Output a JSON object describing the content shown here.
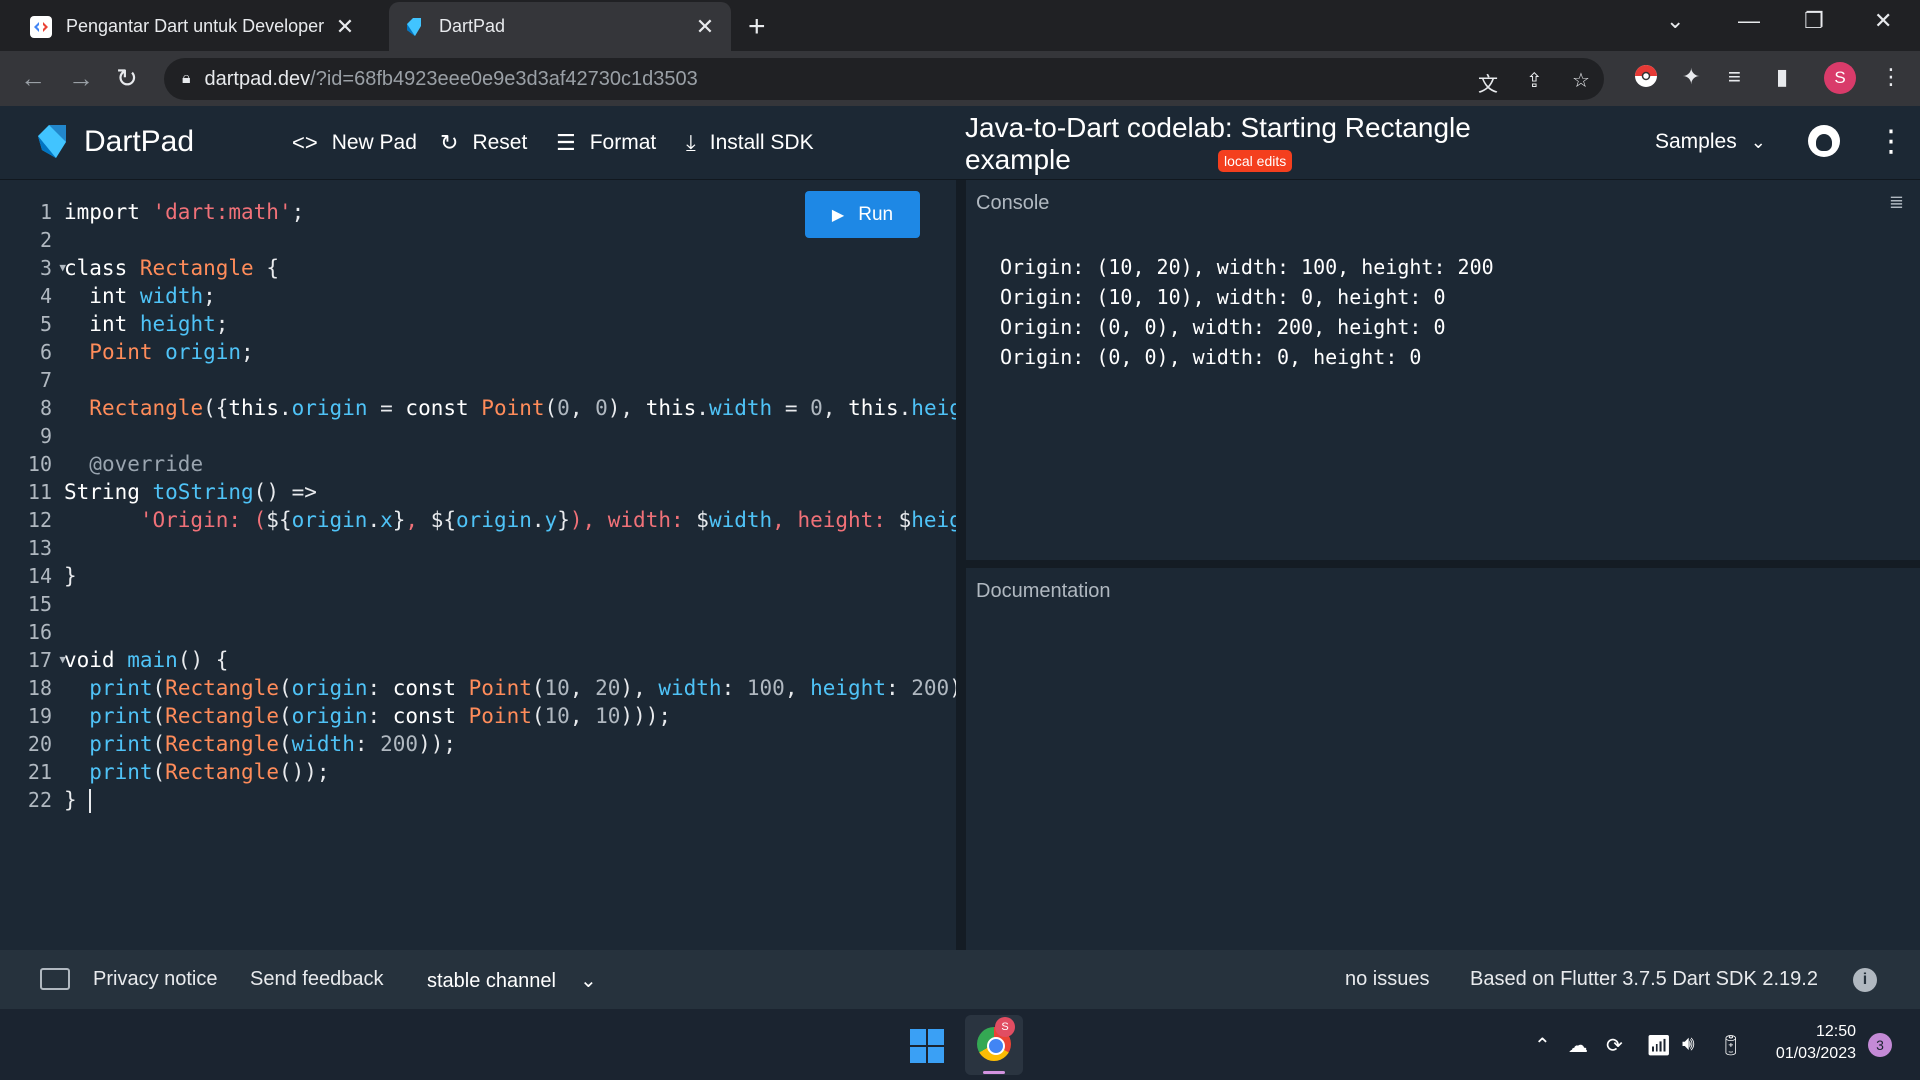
{
  "browser": {
    "tabs": [
      {
        "title": "Pengantar Dart untuk Developer",
        "active": false
      },
      {
        "title": "DartPad",
        "active": true
      }
    ],
    "new_tab": "+",
    "url_host": "dartpad.dev",
    "url_rest": "/?id=68fb4923eee0e9e3d3af42730c1d3503",
    "profile_initial": "S"
  },
  "header": {
    "app_name": "DartPad",
    "new_pad": "New Pad",
    "reset": "Reset",
    "format": "Format",
    "install_sdk": "Install SDK",
    "pad_title": "Java-to-Dart codelab: Starting Rectangle example",
    "badge": "local edits",
    "samples": "Samples"
  },
  "editor": {
    "run_label": "Run",
    "line_numbers": [
      "1",
      "2",
      "3",
      "4",
      "5",
      "6",
      "7",
      "8",
      "9",
      "10",
      "11",
      "12",
      "13",
      "14",
      "15",
      "16",
      "17",
      "18",
      "19",
      "20",
      "21",
      "22"
    ],
    "foldable_lines": [
      3,
      17
    ]
  },
  "console": {
    "title": "Console",
    "output": [
      "Origin: (10, 20), width: 100, height: 200",
      "Origin: (10, 10), width: 0, height: 0",
      "Origin: (0, 0), width: 200, height: 0",
      "Origin: (0, 0), width: 0, height: 0"
    ]
  },
  "documentation": {
    "title": "Documentation"
  },
  "footer": {
    "privacy": "Privacy notice",
    "feedback": "Send feedback",
    "channel": "stable channel",
    "issues": "no issues",
    "sdk": "Based on Flutter 3.7.5 Dart SDK 2.19.2"
  },
  "taskbar": {
    "chrome_badge": "S",
    "time": "12:50",
    "date": "01/03/2023",
    "notifications": "3"
  },
  "colors": {
    "accent": "#1e88e5",
    "badge": "#f43f1e",
    "background": "#1c2834"
  }
}
